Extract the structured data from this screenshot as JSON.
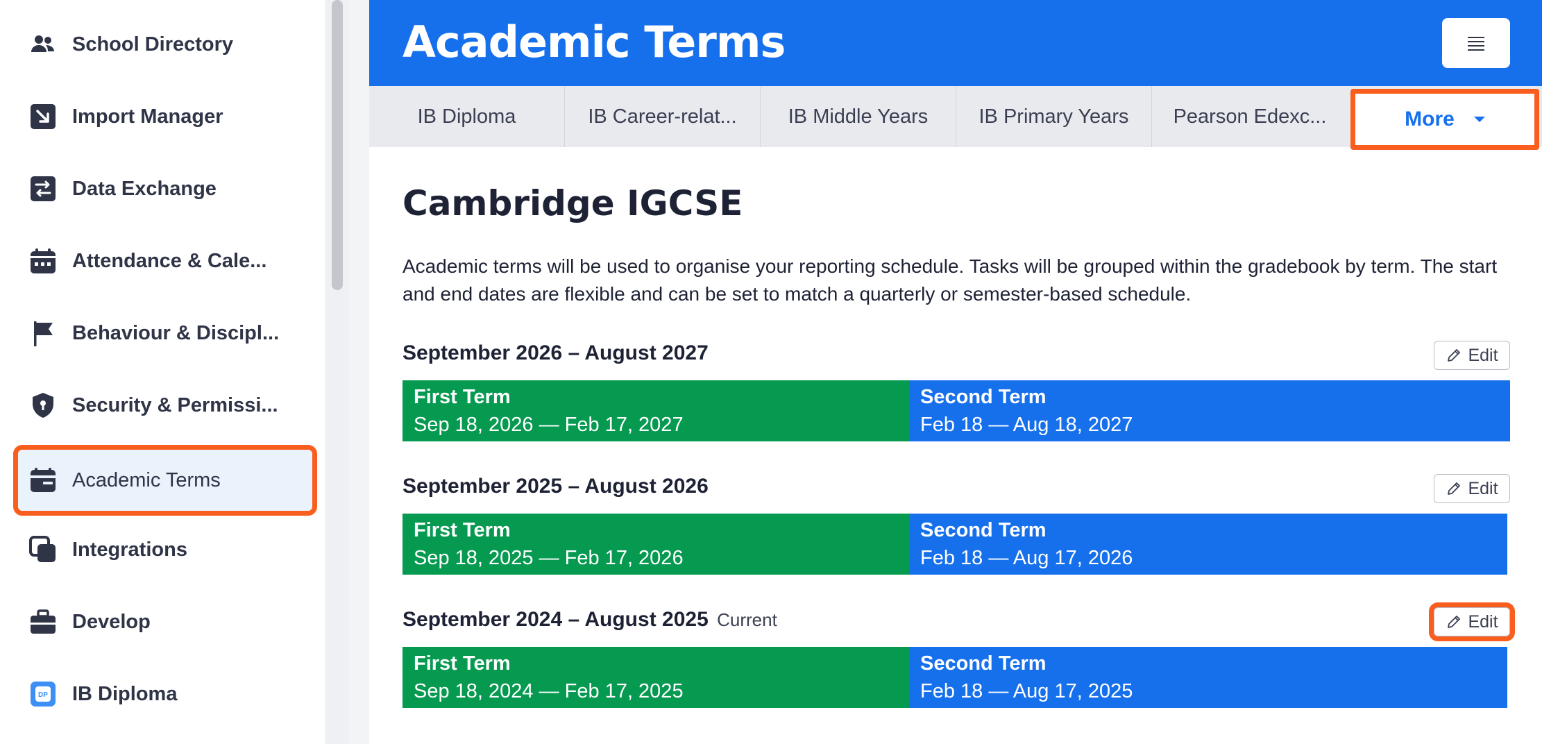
{
  "sidebar": {
    "items": [
      {
        "label": "School Directory",
        "icon": "people-icon"
      },
      {
        "label": "Import Manager",
        "icon": "import-arrow-icon"
      },
      {
        "label": "Data Exchange",
        "icon": "exchange-icon"
      },
      {
        "label": "Attendance & Cale...",
        "icon": "calendar-icon"
      },
      {
        "label": "Behaviour & Discipl...",
        "icon": "flag-icon"
      },
      {
        "label": "Security & Permissi...",
        "icon": "shield-icon"
      },
      {
        "label": "Academic Terms",
        "icon": "terms-card-icon",
        "active": true
      },
      {
        "label": "Integrations",
        "icon": "integrations-icon"
      },
      {
        "label": "Develop",
        "icon": "briefcase-icon"
      },
      {
        "label": "IB Diploma",
        "icon": "dp-badge-icon",
        "badge": "DP"
      }
    ]
  },
  "header": {
    "title": "Academic Terms"
  },
  "tabs": [
    {
      "label": "IB Diploma"
    },
    {
      "label": "IB Career-relat..."
    },
    {
      "label": "IB Middle Years"
    },
    {
      "label": "IB Primary Years"
    },
    {
      "label": "Pearson Edexc..."
    }
  ],
  "more_tab": {
    "label": "More"
  },
  "content": {
    "title": "Cambridge IGCSE",
    "description": "Academic terms will be used to organise your reporting schedule. Tasks will be grouped within the gradebook by term. The start and end dates are flexible and can be set to match a quarterly or semester-based schedule.",
    "edit_label": "Edit",
    "years": [
      {
        "heading": "September 2026 – August 2027",
        "current_label": "",
        "terms": [
          {
            "name": "First Term",
            "dates": "Sep 18, 2026 — Feb 17, 2027"
          },
          {
            "name": "Second Term",
            "dates": "Feb 18 — Aug 18, 2027"
          }
        ]
      },
      {
        "heading": "September 2025 – August 2026",
        "current_label": "",
        "terms": [
          {
            "name": "First Term",
            "dates": "Sep 18, 2025 — Feb 17, 2026"
          },
          {
            "name": "Second Term",
            "dates": "Feb 18 — Aug 17, 2026"
          }
        ]
      },
      {
        "heading": "September 2024 – August 2025",
        "current_label": "Current",
        "terms": [
          {
            "name": "First Term",
            "dates": "Sep 18, 2024 — Feb 17, 2025"
          },
          {
            "name": "Second Term",
            "dates": "Feb 18 — Aug 17, 2025"
          }
        ]
      }
    ]
  },
  "colors": {
    "brand_blue": "#1670ec",
    "term_green": "#069a51",
    "highlight_orange": "#f95e1f",
    "sidebar_icon": "#2f3447"
  }
}
